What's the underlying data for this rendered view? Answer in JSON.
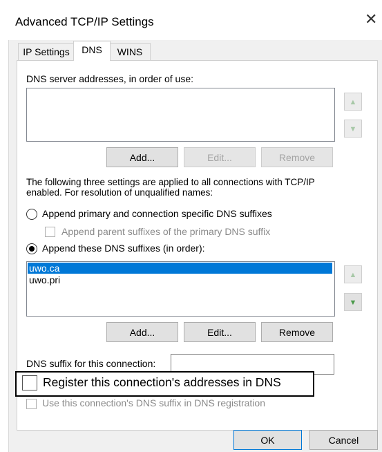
{
  "window": {
    "title": "Advanced TCP/IP Settings",
    "close_icon": "close-icon"
  },
  "tabs": [
    {
      "label": "IP Settings",
      "active": false
    },
    {
      "label": "DNS",
      "active": true
    },
    {
      "label": "WINS",
      "active": false
    }
  ],
  "dns": {
    "servers_label": "DNS server addresses, in order of use:",
    "servers": [],
    "server_buttons": {
      "add": "Add...",
      "edit": "Edit...",
      "remove": "Remove"
    },
    "info_text_line1": "The following three settings are applied to all connections with TCP/IP",
    "info_text_line2": "enabled. For resolution of unqualified names:",
    "radio_primary": {
      "label": "Append primary and connection specific DNS suffixes",
      "checked": false
    },
    "check_parent": {
      "label": "Append parent suffixes of the primary DNS suffix",
      "checked": false,
      "enabled": false
    },
    "radio_these": {
      "label": "Append these DNS suffixes (in order):",
      "checked": true
    },
    "suffixes": [
      "uwo.ca",
      "uwo.pri"
    ],
    "selected_suffix": "uwo.ca",
    "suffix_buttons": {
      "add": "Add...",
      "edit": "Edit...",
      "remove": "Remove"
    },
    "connection_suffix_label": "DNS suffix for this connection:",
    "connection_suffix_value": "",
    "register": {
      "label": "Register this connection's addresses in DNS",
      "checked": false
    },
    "use_suffix": {
      "label": "Use this connection's DNS suffix in DNS registration",
      "checked": false,
      "enabled": false
    }
  },
  "footer": {
    "ok": "OK",
    "cancel": "Cancel"
  },
  "colors": {
    "selection": "#0078d7",
    "arrow_green": "#4a9a4a"
  }
}
